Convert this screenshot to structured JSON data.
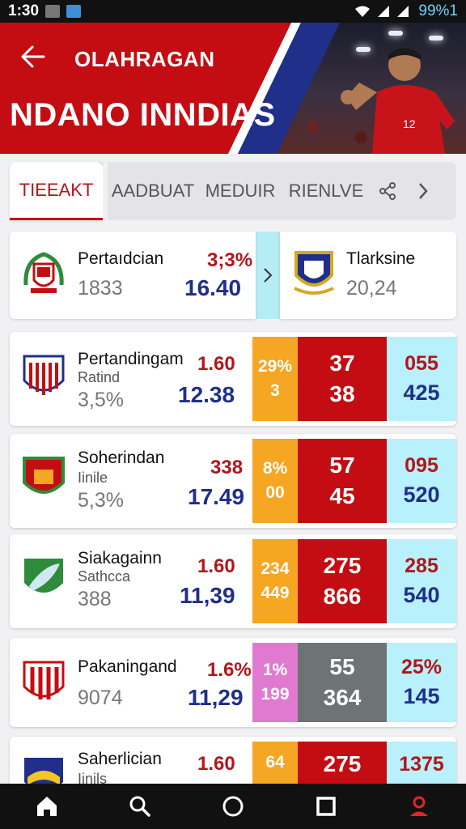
{
  "status_bar": {
    "time": "1:30",
    "battery": "99%1"
  },
  "header": {
    "section_title": "OLAHRAGAN",
    "hero_title": "NDANO INNDIAS",
    "player_number": "12"
  },
  "tabs": [
    "TIEEAKT",
    "AADBUAT",
    "MEDUIR",
    "RIENLVE"
  ],
  "match": {
    "home": {
      "name": "Pertaıdcian",
      "value": "1833",
      "odds_top": "3;3%",
      "odds": "16.40"
    },
    "away": {
      "name": "Tlarksine",
      "value": "20,24"
    }
  },
  "rows": [
    {
      "name": "Pertandingam",
      "sub": "Ratind",
      "value": "3,5%",
      "odds_top": "1.60",
      "odds": "12.38",
      "c1": [
        "29%",
        "3"
      ],
      "c2": [
        "37",
        "38"
      ],
      "c3": [
        "055",
        "425"
      ],
      "c1_color": "#f5a623",
      "c2_color": "#c40d12",
      "c3_color": "#b8f0fb"
    },
    {
      "name": "Soherindan",
      "sub": "Iinile",
      "value": "5,3%",
      "odds_top": "338",
      "odds": "17.49",
      "c1": [
        "8%",
        "00"
      ],
      "c2": [
        "57",
        "45"
      ],
      "c3": [
        "095",
        "520"
      ],
      "c1_color": "#f5a623",
      "c2_color": "#c40d12",
      "c3_color": "#b8f0fb"
    },
    {
      "name": "Siakagainn",
      "sub": "Sathcca",
      "value": "388",
      "odds_top": "1.60",
      "odds": "11,39",
      "c1": [
        "234",
        "449"
      ],
      "c2": [
        "275",
        "866"
      ],
      "c3": [
        "285",
        "540"
      ],
      "c1_color": "#f5a623",
      "c2_color": "#c40d12",
      "c3_color": "#b8f0fb"
    },
    {
      "name": "Pakaningand",
      "sub": "",
      "value": "9074",
      "odds_top": "1.6%",
      "odds": "11,29",
      "c1": [
        "1%",
        "199"
      ],
      "c2": [
        "55",
        "364"
      ],
      "c3": [
        "25%",
        "145"
      ],
      "c1_color": "#e07ad0",
      "c2_color": "#6e7373",
      "c3_color": "#b8f0fb"
    },
    {
      "name": "Saherlician",
      "sub": "Iinils",
      "value": "",
      "odds_top": "1.60",
      "odds": "",
      "c1": [
        "64",
        ""
      ],
      "c2": [
        "275",
        ""
      ],
      "c3": [
        "1375",
        ""
      ],
      "c1_color": "#f5a623",
      "c2_color": "#c40d12",
      "c3_color": "#b8f0fb"
    }
  ],
  "icons": {
    "back": "arrow-left-icon",
    "share": "share-icon",
    "next": "chevron-right-icon",
    "nav": [
      "home-icon",
      "search-icon",
      "circle-icon",
      "square-icon",
      "profile-icon"
    ]
  },
  "colors": {
    "brand_red": "#c40d12",
    "brand_blue": "#1f2f8a",
    "accent_cyan": "#b8f0fb"
  }
}
